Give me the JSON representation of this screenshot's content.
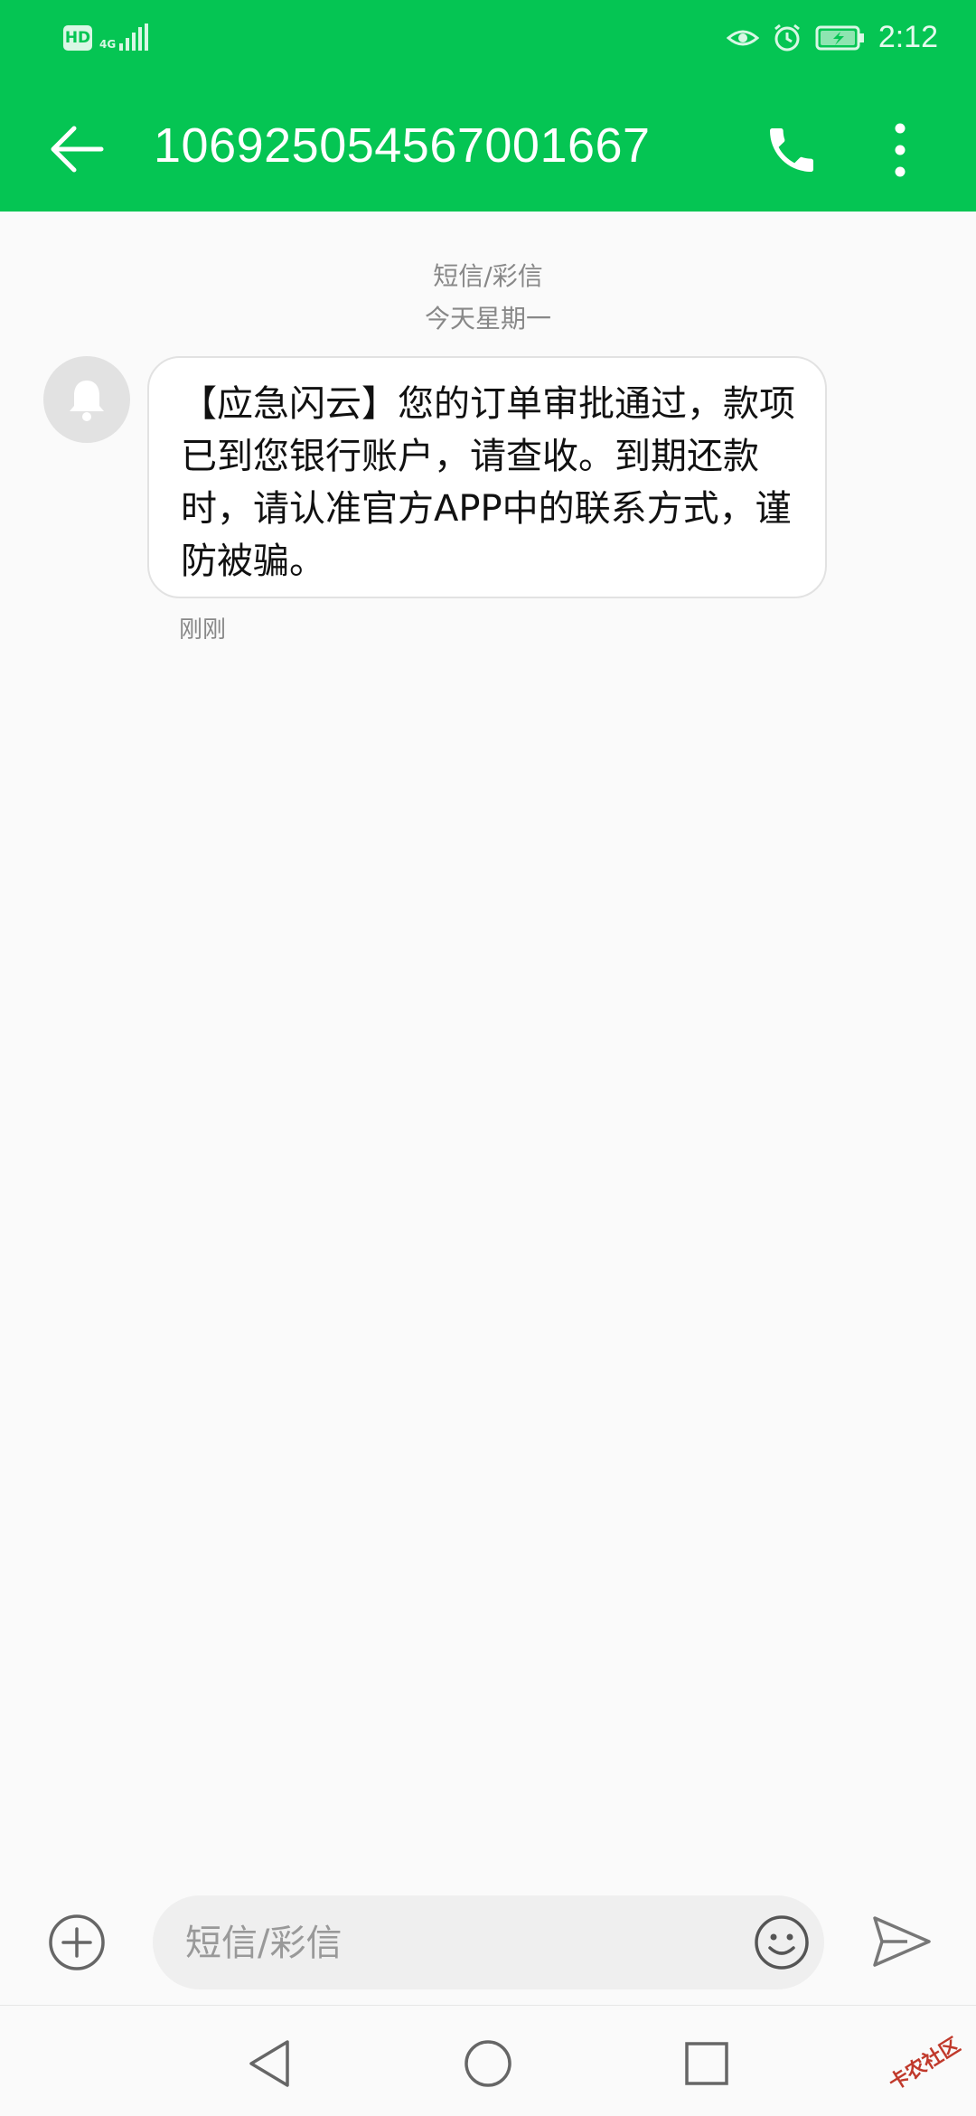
{
  "status_bar": {
    "hd_badge": "HD",
    "network": "4G",
    "time": "2:12",
    "icons": [
      "eye-comfort-icon",
      "alarm-icon",
      "battery-charging-icon"
    ]
  },
  "header": {
    "title": "1069250545670​01667",
    "actions": [
      "call-icon",
      "more-vert-icon"
    ],
    "accent_color": "#05c553"
  },
  "conversation": {
    "channel_label": "短信/彩信",
    "date_label": "今天星期一",
    "messages": [
      {
        "text": "【应急闪云】您的订单审批通过，款项已到您银行账户，请查收。到期还款时，请认准官方APP中的联系方式，谨防被骗。",
        "time": "刚刚",
        "avatar_icon": "bell-icon"
      }
    ]
  },
  "composer": {
    "placeholder": "短信/彩信",
    "value": ""
  },
  "watermark": "卡农社区"
}
